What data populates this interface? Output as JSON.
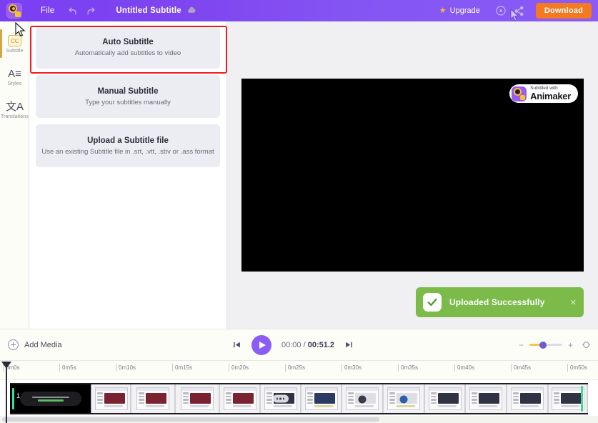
{
  "header": {
    "logo_icon": "animaker-logo-icon",
    "file_menu": "File",
    "undo_icon": "undo-icon",
    "redo_icon": "redo-icon",
    "doc_title": "Untitled Subtitle",
    "cloud_icon": "cloud-save-icon",
    "upgrade_label": "Upgrade",
    "upgrade_star": "★",
    "preview_icon": "preview-play-icon",
    "share_icon": "share-icon",
    "download_label": "Download"
  },
  "sidebar": {
    "items": [
      {
        "label": "Subtitle",
        "icon": "closed-caption-icon",
        "glyph": "CC",
        "active": true
      },
      {
        "label": "Styles",
        "icon": "text-styles-icon",
        "glyph": "A≡",
        "active": false
      },
      {
        "label": "Translations",
        "icon": "translate-icon",
        "glyph": "文A",
        "active": false
      }
    ]
  },
  "options": {
    "cards": [
      {
        "title": "Auto Subtitle",
        "subtitle": "Automatically add subtitles to video",
        "selected": true
      },
      {
        "title": "Manual Subtitle",
        "subtitle": "Type your subtitles manually",
        "selected": false
      },
      {
        "title": "Upload a Subtitle file",
        "subtitle": "Use an existing Subtitle file in .srt, .vtt, .sbv or .ass format",
        "selected": false
      }
    ],
    "highlight_color": "#f01c1c"
  },
  "stage": {
    "watermark_top": "Subtitled with",
    "watermark_bottom": "Animaker",
    "watermark_icon": "animaker-logo-icon"
  },
  "toast": {
    "message": "Uploaded Successfully",
    "check_icon": "check-icon",
    "close_icon": "close-icon",
    "color": "#7cbb4a"
  },
  "transport": {
    "add_media_label": "Add Media",
    "add_media_icon": "plus-circle-icon",
    "skip_start_icon": "skip-to-start-icon",
    "play_icon": "play-icon",
    "skip_end_icon": "skip-to-end-icon",
    "current_time": "00:00",
    "time_separator": " / ",
    "total_time": "00:51.2",
    "zoom_out_icon": "minus-icon",
    "zoom_in_icon": "plus-icon",
    "fit_icon": "fit-to-screen-icon",
    "zoom_percent": 40
  },
  "timeline": {
    "ticks": [
      "0m0s",
      "0m5s",
      "0m10s",
      "0m15s",
      "0m20s",
      "0m25s",
      "0m30s",
      "0m35s",
      "0m40s",
      "0m45s",
      "0m50s"
    ],
    "clip_number": "1",
    "playhead_time": "0m0s"
  }
}
